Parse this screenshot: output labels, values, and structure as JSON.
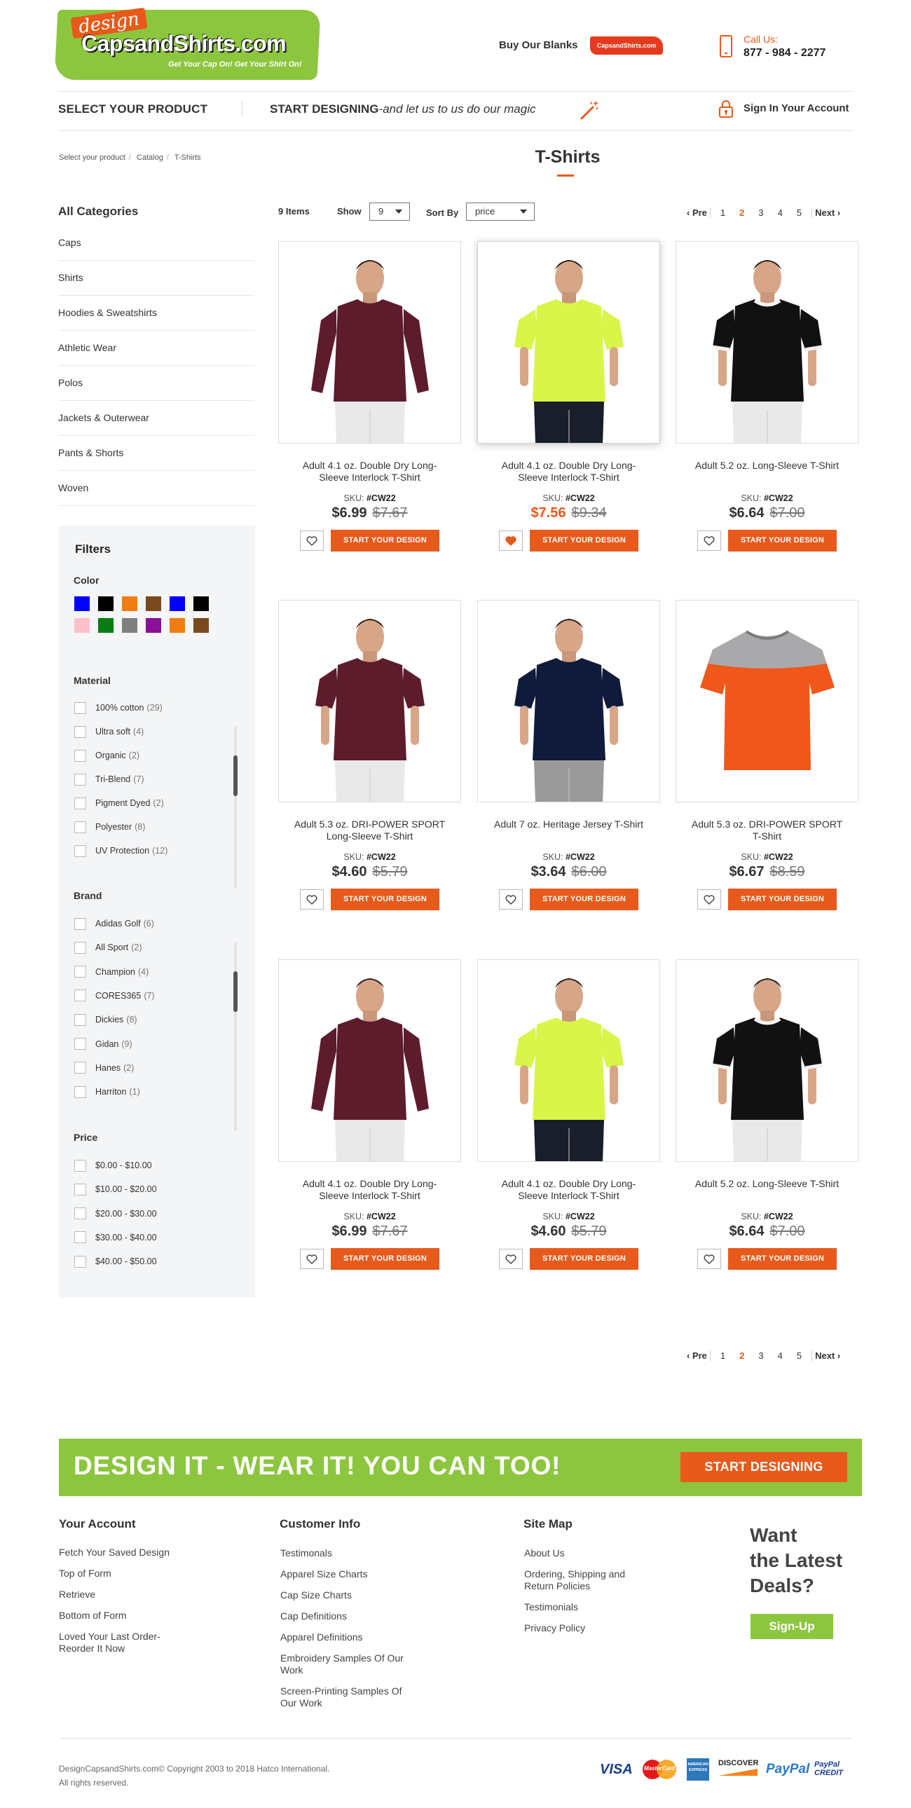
{
  "header": {
    "logo_design": "design",
    "logo_name": "CapsandShirts.com",
    "logo_tagline": "Get Your Cap On! Get Your Shirt On!",
    "buy_blanks": "Buy Our Blanks",
    "blanks_badge": "CapsandShirts.com",
    "call_label": "Call Us:",
    "call_number": "877 - 984 - 2277"
  },
  "nav": {
    "select_product": "SELECT YOUR PRODUCT",
    "start_designing": "START DESIGNING",
    "start_designing_tail": "-and let us to us do our magic",
    "sign_in": "Sign In Your Account"
  },
  "breadcrumb": [
    "Select your product",
    "Catalog",
    "T-Shirts"
  ],
  "page_title": "T-Shirts",
  "sidebar": {
    "categories_title": "All Categories",
    "categories": [
      "Caps",
      "Shirts",
      "Hoodies & Sweatshirts",
      "Athletic Wear",
      "Polos",
      "Jackets & Outerwear",
      "Pants & Shorts",
      "Woven"
    ],
    "filters_title": "Filters",
    "color_title": "Color",
    "colors": [
      "#0000ff",
      "#000000",
      "#f07c12",
      "#7a4a1f",
      "#0000ff",
      "#000000",
      "#ffc0cb",
      "#0a7d12",
      "#7f7f7f",
      "#8a0f99",
      "#f07c12",
      "#7a4a1f"
    ],
    "material_title": "Material",
    "materials": [
      {
        "label": "100% cotton",
        "count": "(29)"
      },
      {
        "label": "Ultra soft",
        "count": "(4)"
      },
      {
        "label": "Organic",
        "count": "(2)"
      },
      {
        "label": "Tri-Blend",
        "count": "(7)"
      },
      {
        "label": "Pigment Dyed",
        "count": "(2)"
      },
      {
        "label": "Polyester",
        "count": "(8)"
      },
      {
        "label": "UV Protection",
        "count": "(12)"
      }
    ],
    "brand_title": "Brand",
    "brands": [
      {
        "label": "Adidas Golf",
        "count": "(6)"
      },
      {
        "label": "All Sport",
        "count": "(2)"
      },
      {
        "label": "Champion",
        "count": "(4)"
      },
      {
        "label": "CORES365",
        "count": "(7)"
      },
      {
        "label": "Dickies",
        "count": "(8)"
      },
      {
        "label": "Gidan",
        "count": "(9)"
      },
      {
        "label": "Hanes",
        "count": "(2)"
      },
      {
        "label": "Harriton",
        "count": "(1)"
      }
    ],
    "price_title": "Price",
    "prices": [
      "$0.00 - $10.00",
      "$10.00 - $20.00",
      "$20.00 - $30.00",
      "$30.00 - $40.00",
      "$40.00 - $50.00"
    ]
  },
  "toolbar": {
    "items_count": "9 Items",
    "show_label": "Show",
    "show_value": "9",
    "sort_label": "Sort By",
    "sort_value": "price",
    "pager_prev": "‹ Pre",
    "pager_pages": [
      "1",
      "2",
      "3",
      "4",
      "5"
    ],
    "pager_active": "2",
    "pager_next": "Next ›"
  },
  "products": [
    {
      "name": "Adult 4.1 oz. Double Dry Long-Sleeve Interlock T-Shirt",
      "sku_label": "SKU:",
      "sku": "#CW22",
      "price": "$6.99",
      "old_price": "$7.67",
      "cta": "START YOUR DESIGN",
      "shirt_color": "#5c1c2c",
      "style": "long"
    },
    {
      "name": "Adult 4.1 oz. Double Dry Long-Sleeve Interlock T-Shirt",
      "sku_label": "SKU:",
      "sku": "#CW22",
      "price": "$7.56",
      "old_price": "$9.34",
      "cta": "START YOUR DESIGN",
      "shirt_color": "#d9f54a",
      "style": "short",
      "highlighted": true
    },
    {
      "name": "Adult 5.2 oz. Long-Sleeve T-Shirt",
      "sku_label": "SKU:",
      "sku": "#CW22",
      "price": "$6.64",
      "old_price": "$7.00",
      "cta": "START YOUR DESIGN",
      "shirt_color": "#111111",
      "style": "ringer"
    },
    {
      "name": "Adult 5.3 oz. DRI-POWER SPORT Long-Sleeve T-Shirt",
      "sku_label": "SKU:",
      "sku": "#CW22",
      "price": "$4.60",
      "old_price": "$5.79",
      "cta": "START YOUR DESIGN",
      "shirt_color": "#5c1c2c",
      "style": "short"
    },
    {
      "name": "Adult 7 oz. Heritage Jersey T-Shirt",
      "sku_label": "SKU:",
      "sku": "#CW22",
      "price": "$3.64",
      "old_price": "$6.00",
      "cta": "START YOUR DESIGN",
      "shirt_color": "#101a3a",
      "style": "short"
    },
    {
      "name": "Adult 5.3 oz. DRI-POWER SPORT T-Shirt",
      "sku_label": "SKU:",
      "sku": "#CW22",
      "price": "$6.67",
      "old_price": "$8.59",
      "cta": "START YOUR DESIGN",
      "shirt_color": "#f0571b",
      "style": "flat"
    },
    {
      "name": "Adult 4.1 oz. Double Dry Long-Sleeve Interlock T-Shirt",
      "sku_label": "SKU:",
      "sku": "#CW22",
      "price": "$6.99",
      "old_price": "$7.67",
      "cta": "START YOUR DESIGN",
      "shirt_color": "#5c1c2c",
      "style": "long"
    },
    {
      "name": "Adult 4.1 oz. Double Dry Long-Sleeve Interlock T-Shirt",
      "sku_label": "SKU:",
      "sku": "#CW22",
      "price": "$4.60",
      "old_price": "$5.79",
      "cta": "START YOUR DESIGN",
      "shirt_color": "#d9f54a",
      "style": "short"
    },
    {
      "name": "Adult 5.2 oz. Long-Sleeve T-Shirt",
      "sku_label": "SKU:",
      "sku": "#CW22",
      "price": "$6.64",
      "old_price": "$7.00",
      "cta": "START YOUR DESIGN",
      "shirt_color": "#111111",
      "style": "ringer"
    }
  ],
  "banner": {
    "text": "DESIGN IT - WEAR IT!  YOU CAN TOO!",
    "button": "START DESIGNING"
  },
  "footer": {
    "account_title": "Your Account",
    "account_links": [
      "Fetch Your Saved Design",
      "Top of Form",
      "Retrieve",
      "Bottom of Form",
      "Loved Your Last Order- Reorder It Now"
    ],
    "customer_title": "Customer Info",
    "customer_links": [
      "Testimonals",
      "Apparel Size Charts",
      "Cap Size Charts",
      "Cap Definitions",
      "Apparel Definitions",
      "Embroidery Samples Of Our Work",
      "Screen-Printing Samples Of Our Work"
    ],
    "sitemap_title": "Site Map",
    "sitemap_links": [
      "About Us",
      "Ordering, Shipping and Return Policies",
      "Testimonials",
      "Privacy Policy"
    ],
    "deals_line1": "Want",
    "deals_line2": "the Latest",
    "deals_line3": "Deals?",
    "signup": "Sign-Up",
    "copyright_line1": "DesignCapsandShirts.com© Copyright 2003 to 2018 Hatco International.",
    "copyright_line2": "All rights reserved.",
    "payments": [
      "VISA",
      "MasterCard",
      "AMERICAN EXPRESS",
      "DISCOVER",
      "PayPal",
      "PayPal CREDIT"
    ]
  },
  "colors": {
    "accent": "#e85a1b",
    "brand_green": "#8cc63f"
  }
}
